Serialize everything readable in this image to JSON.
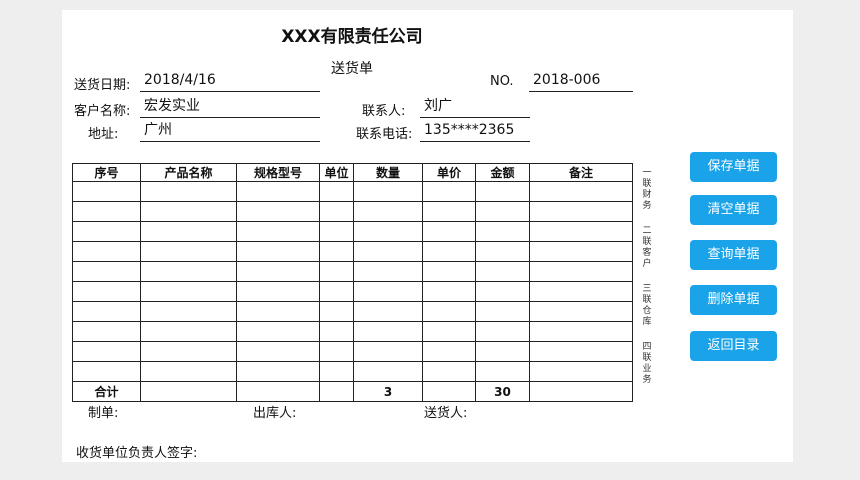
{
  "header": {
    "company": "XXX有限责任公司",
    "doc_type": "送货单"
  },
  "form": {
    "date_label": "送货日期:",
    "date_value": "2018/4/16",
    "no_label": "NO.",
    "no_value": "2018-006",
    "customer_label": "客户名称:",
    "customer_value": "宏发实业",
    "contact_label": "联系人:",
    "contact_value": "刘广",
    "address_label": "地址:",
    "address_value": "广州",
    "phone_label": "联系电话:",
    "phone_value": "135****2365"
  },
  "table": {
    "columns": [
      "序号",
      "产品名称",
      "规格型号",
      "单位",
      "数量",
      "单价",
      "金额",
      "备注"
    ],
    "total": {
      "label": "合计",
      "quantity": "3",
      "amount": "30"
    }
  },
  "copies": [
    "一联财务",
    "二联客户",
    "三联仓库",
    "四联业务"
  ],
  "buttons": {
    "save": "保存单据",
    "clear": "清空单据",
    "query": "查询单据",
    "delete": "删除单据",
    "back": "返回目录"
  },
  "footer": {
    "maker": "制单:",
    "warehouse": "出库人:",
    "deliverer": "送货人:",
    "receiver_sign": "收货单位负责人签字:"
  }
}
